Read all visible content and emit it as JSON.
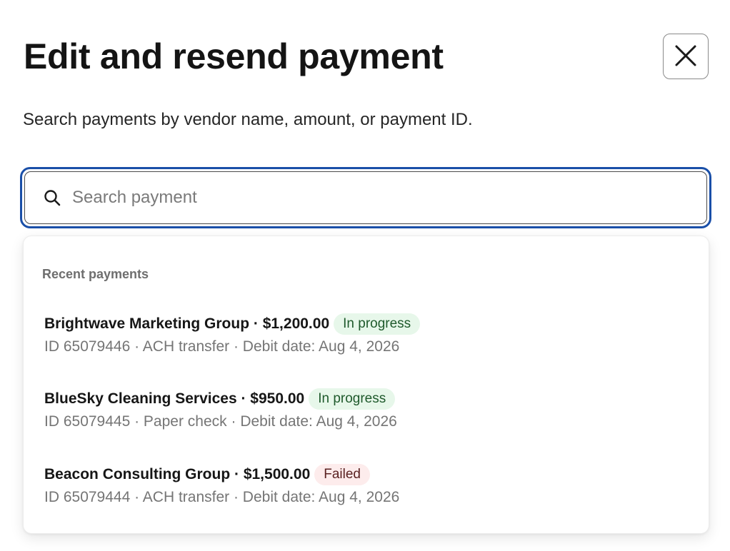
{
  "modal": {
    "title": "Edit and resend payment",
    "subtitle": "Search payments by vendor name, amount, or payment ID.",
    "close_icon": "close-icon"
  },
  "search": {
    "placeholder": "Search payment",
    "value": "",
    "icon": "search-icon",
    "focus_color": "#1a4fa8"
  },
  "recent": {
    "heading": "Recent payments",
    "items": [
      {
        "title": "Brightwave Marketing Group · $1,200.00",
        "status": "In progress",
        "details": "ID 65079446 · ACH transfer · Debit date: Aug 4, 2026"
      },
      {
        "title": "BlueSky Cleaning Services · $950.00",
        "status": "In progress",
        "details": "ID 65079445 · Paper check · Debit date: Aug 4, 2026"
      },
      {
        "title": "Beacon Consulting Group · $1,500.00",
        "status": "Failed",
        "details": "ID 65079444 · ACH transfer · Debit date: Aug 4, 2026"
      }
    ]
  },
  "colors": {
    "status_in_progress_bg": "#e7f7ea",
    "status_failed_bg": "#fdecec"
  }
}
